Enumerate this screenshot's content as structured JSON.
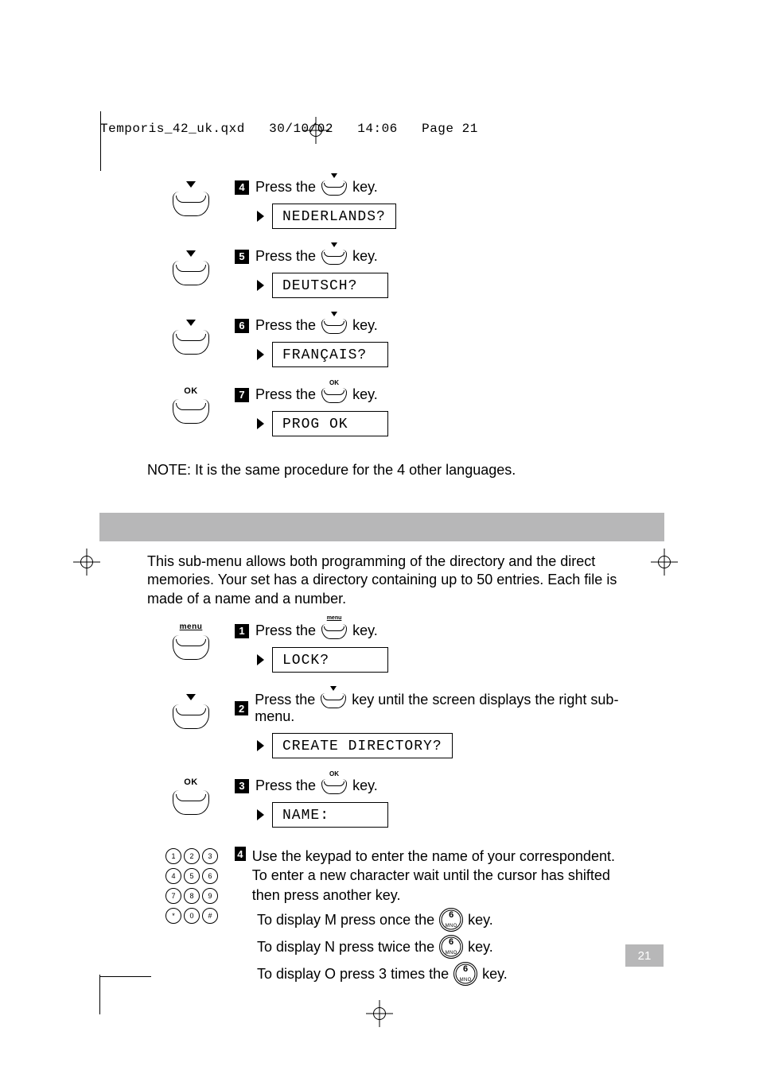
{
  "header": {
    "file": "Temporis_42_uk.qxd",
    "date": "30/10/02",
    "time": "14:06",
    "page_label": "Page 21"
  },
  "upper_steps": [
    {
      "num": "4",
      "softkey": "down",
      "text_prefix": "Press the ",
      "text_suffix": " key.",
      "lcd": "NEDERLANDS?"
    },
    {
      "num": "5",
      "softkey": "down",
      "text_prefix": "Press the ",
      "text_suffix": " key.",
      "lcd": "DEUTSCH?"
    },
    {
      "num": "6",
      "softkey": "down",
      "text_prefix": "Press the ",
      "text_suffix": " key.",
      "lcd": "FRANÇAIS?"
    },
    {
      "num": "7",
      "softkey": "ok",
      "text_prefix": "Press the ",
      "text_suffix": " key.",
      "lcd": "PROG OK"
    }
  ],
  "note": "NOTE: It is the same procedure for the 4 other languages.",
  "intro_paragraph": "This sub-menu allows both programming of the directory and the direct memories. Your set has a directory containing up to 50 entries. Each file is made of a name and a number.",
  "lower_steps": {
    "s1": {
      "num": "1",
      "softkey": "menu",
      "text_prefix": "Press the ",
      "text_suffix": " key.",
      "lcd": "LOCK?"
    },
    "s2": {
      "num": "2",
      "softkey": "down",
      "text_prefix": "Press the ",
      "text_suffix": " key until the screen displays the right sub-menu.",
      "lcd": "CREATE DIRECTORY?"
    },
    "s3": {
      "num": "3",
      "softkey": "ok",
      "text_prefix": "Press the ",
      "text_suffix": " key.",
      "lcd": "NAME:"
    },
    "s4": {
      "num": "4",
      "line1": "Use the keypad to enter the name of your correspondent.",
      "line2": "To enter a new character wait until the cursor has shifted then press another key.",
      "display_lines": {
        "m": {
          "pre": "To display M press once the ",
          "post": " key."
        },
        "n": {
          "pre": "To display N press twice the ",
          "post": " key."
        },
        "o": {
          "pre": "To display O press 3 times the ",
          "post": " key."
        }
      }
    }
  },
  "round_key": {
    "digit": "6",
    "letters": "MNO"
  },
  "softkey_labels": {
    "ok": "OK",
    "menu": "menu"
  },
  "keypad_labels": [
    "1",
    "2",
    "3",
    "4",
    "5",
    "6",
    "7",
    "8",
    "9",
    "*",
    "0",
    "#"
  ],
  "page_number": "21"
}
